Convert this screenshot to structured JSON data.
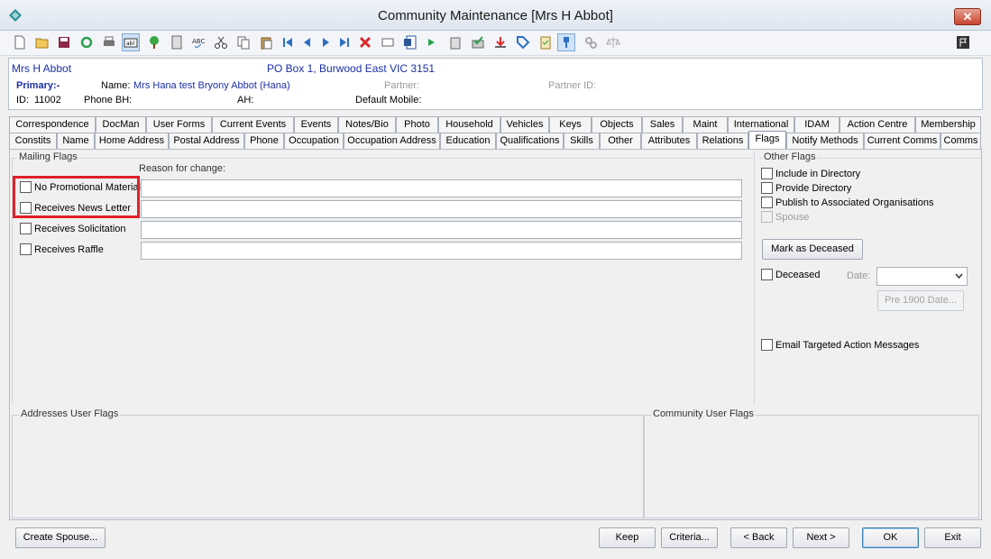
{
  "window": {
    "title": "Community Maintenance  [Mrs H Abbot]",
    "close_glyph": "✕"
  },
  "toolbar": {
    "icons": [
      "new-icon",
      "open-icon",
      "save-icon",
      "refresh-icon",
      "print-icon",
      "field-icon",
      "tree-icon",
      "calculator-icon",
      "spellcheck-icon",
      "cut-icon",
      "copy-icon",
      "paste-icon",
      "first-record-icon",
      "previous-record-icon",
      "next-record-icon",
      "last-record-icon",
      "delete-icon",
      "envelope-icon",
      "word-document-icon",
      "forward-icon",
      "clipboard-icon",
      "approve-icon",
      "download-icon",
      "tag-icon",
      "checklist-icon",
      "pin-icon",
      "gears-icon",
      "scale-icon",
      "flag-icon"
    ]
  },
  "header": {
    "display_name": "Mrs H Abbot",
    "address": "PO Box 1, Burwood East VIC 3151",
    "primary_label": "Primary:-",
    "name_label": "Name:",
    "name_value": "Mrs Hana test Bryony Abbot (Hana)",
    "partner_label": "Partner:",
    "partner_id_label": "Partner ID:",
    "id_label": "ID:",
    "id_value": "11002",
    "phone_bh_label": "Phone BH:",
    "ah_label": "AH:",
    "default_mobile_label": "Default Mobile:"
  },
  "tabs": {
    "row1": [
      "Correspondence",
      "DocMan",
      "User Forms",
      "Current Events",
      "Events",
      "Notes/Bio",
      "Photo",
      "Household",
      "Vehicles",
      "Keys",
      "Objects",
      "Sales",
      "Maint",
      "International",
      "IDAM",
      "Action Centre",
      "Membership"
    ],
    "row2": [
      "Constits",
      "Name",
      "Home Address",
      "Postal Address",
      "Phone",
      "Occupation",
      "Occupation Address",
      "Education",
      "Qualifications",
      "Skills",
      "Other",
      "Attributes",
      "Relations",
      "Flags",
      "Notify Methods",
      "Current Comms",
      "Comms"
    ],
    "active": "Flags"
  },
  "mailing_flags": {
    "title": "Mailing Flags",
    "reason_label": "Reason for change:",
    "items": [
      {
        "label": "No Promotional Material",
        "checked": false,
        "reason": ""
      },
      {
        "label": "Receives News Letter",
        "checked": false,
        "reason": ""
      },
      {
        "label": "Receives Solicitation",
        "checked": false,
        "reason": ""
      },
      {
        "label": "Receives Raffle",
        "checked": false,
        "reason": ""
      }
    ]
  },
  "other_flags": {
    "title": "Other Flags",
    "include_directory": "Include in Directory",
    "provide_directory": "Provide Directory",
    "publish_orgs": "Publish to Associated Organisations",
    "spouse": "Spouse",
    "mark_deceased_button": "Mark as Deceased",
    "deceased_label": "Deceased",
    "date_label": "Date:",
    "date_value": "",
    "pre1900_button": "Pre 1900 Date...",
    "email_targeted": "Email Targeted Action Messages"
  },
  "user_flags": {
    "addresses_title": "Addresses User Flags",
    "community_title": "Community User Flags"
  },
  "footer": {
    "create_spouse": "Create Spouse...",
    "keep": "Keep",
    "criteria": "Criteria...",
    "back": "< Back",
    "next": "Next >",
    "ok": "OK",
    "exit": "Exit"
  },
  "colors": {
    "highlight": "#e02027",
    "header_blue": "#1b2fa8"
  }
}
